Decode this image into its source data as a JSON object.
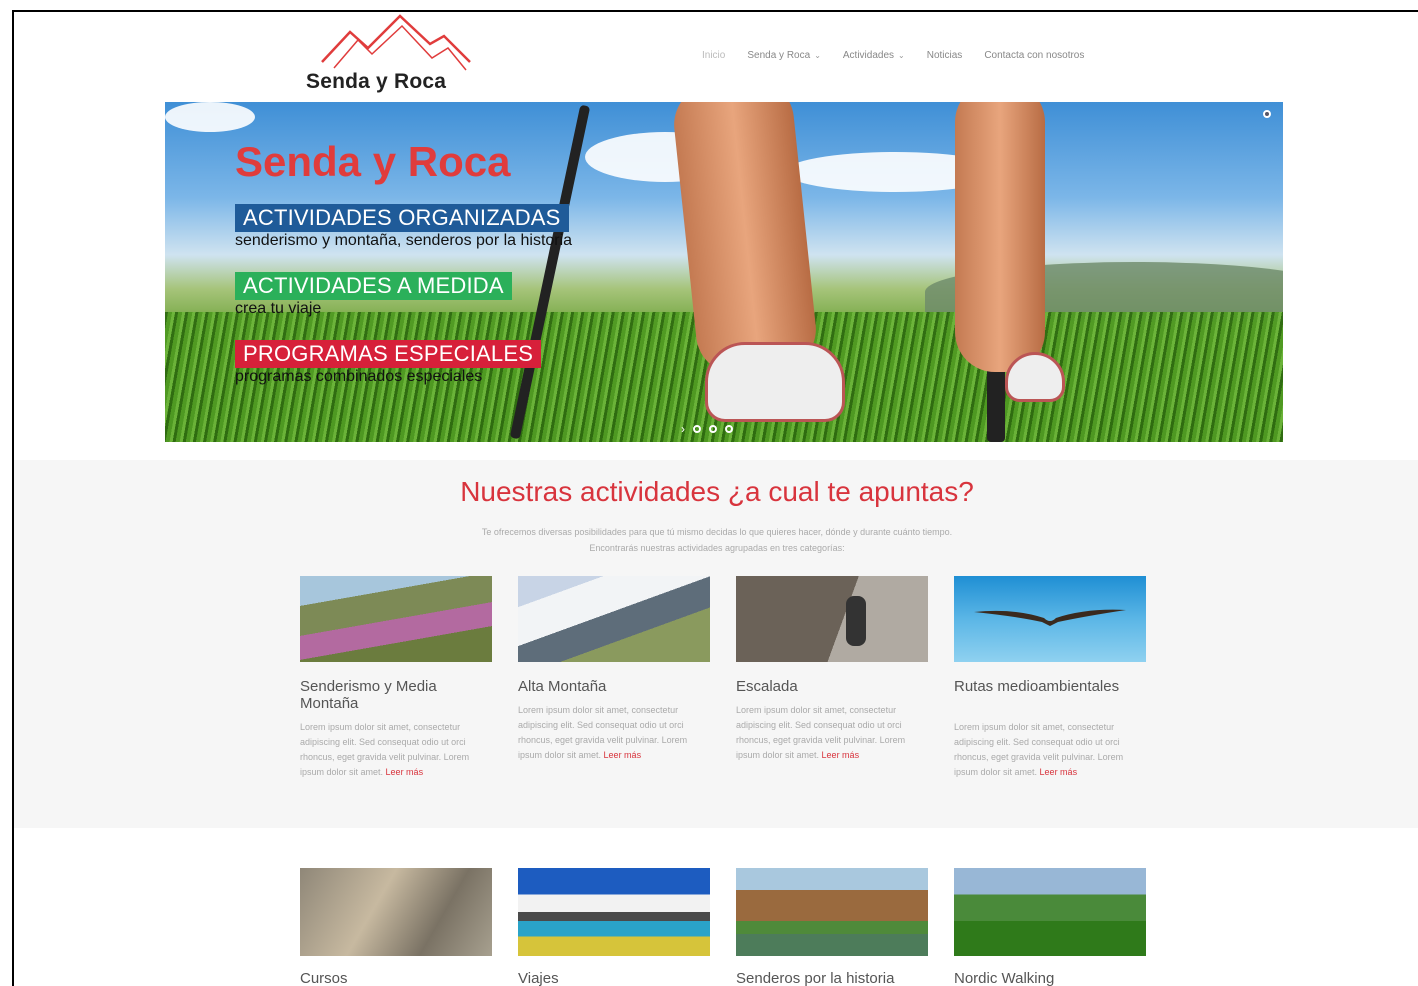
{
  "header": {
    "logo_text": "Senda y Roca",
    "nav": [
      {
        "label": "Inicio",
        "dropdown": false
      },
      {
        "label": "Senda y Roca",
        "dropdown": true
      },
      {
        "label": "Actividades",
        "dropdown": true
      },
      {
        "label": "Noticias",
        "dropdown": false
      },
      {
        "label": "Contacta con nosotros",
        "dropdown": false
      }
    ]
  },
  "hero": {
    "title": "Senda y Roca",
    "slides": [
      {
        "tag": "ACTIVIDADES ORGANIZADAS",
        "subtitle": "senderismo y montaña, senderos por la historia"
      },
      {
        "tag": "ACTIVIDADES A MEDIDA",
        "subtitle": "crea tu viaje"
      },
      {
        "tag": "PROGRAMAS ESPECIALES",
        "subtitle": "programas combinados especiales"
      }
    ]
  },
  "activities": {
    "title": "Nuestras actividades ¿a cual te apuntas?",
    "description_line1": "Te ofrecemos diversas posibilidades para que tú mismo decidas lo que quieres hacer, dónde y durante cuánto tiempo.",
    "description_line2": "Encontrarás nuestras actividades agrupadas en tres categorías:",
    "more_label": "Leer más",
    "cards": [
      {
        "title": "Senderismo y Media Montaña",
        "body": "Lorem ipsum dolor sit amet, consectetur adipiscing elit. Sed consequat odio ut orci rhoncus, eget gravida velit pulvinar. Lorem ipsum dolor sit amet."
      },
      {
        "title": "Alta Montaña",
        "body": "Lorem ipsum dolor sit amet, consectetur adipiscing elit. Sed consequat odio ut orci rhoncus, eget gravida velit pulvinar. Lorem ipsum dolor sit amet."
      },
      {
        "title": "Escalada",
        "body": "Lorem ipsum dolor sit amet, consectetur adipiscing elit. Sed consequat odio ut orci rhoncus, eget gravida velit pulvinar. Lorem ipsum dolor sit amet."
      },
      {
        "title": "Rutas medioambientales",
        "body": "Lorem ipsum dolor sit amet, consectetur adipiscing elit. Sed consequat odio ut orci rhoncus, eget gravida velit pulvinar. Lorem ipsum dolor sit amet."
      }
    ]
  },
  "more_activities": {
    "cards": [
      {
        "title": "Cursos"
      },
      {
        "title": "Viajes"
      },
      {
        "title": "Senderos por la historia"
      },
      {
        "title": "Nordic Walking"
      }
    ]
  },
  "colors": {
    "accent_red": "#d8343d",
    "tag_blue": "#1f5b99",
    "tag_green": "#2bb05a",
    "tag_red": "#d7203a"
  }
}
